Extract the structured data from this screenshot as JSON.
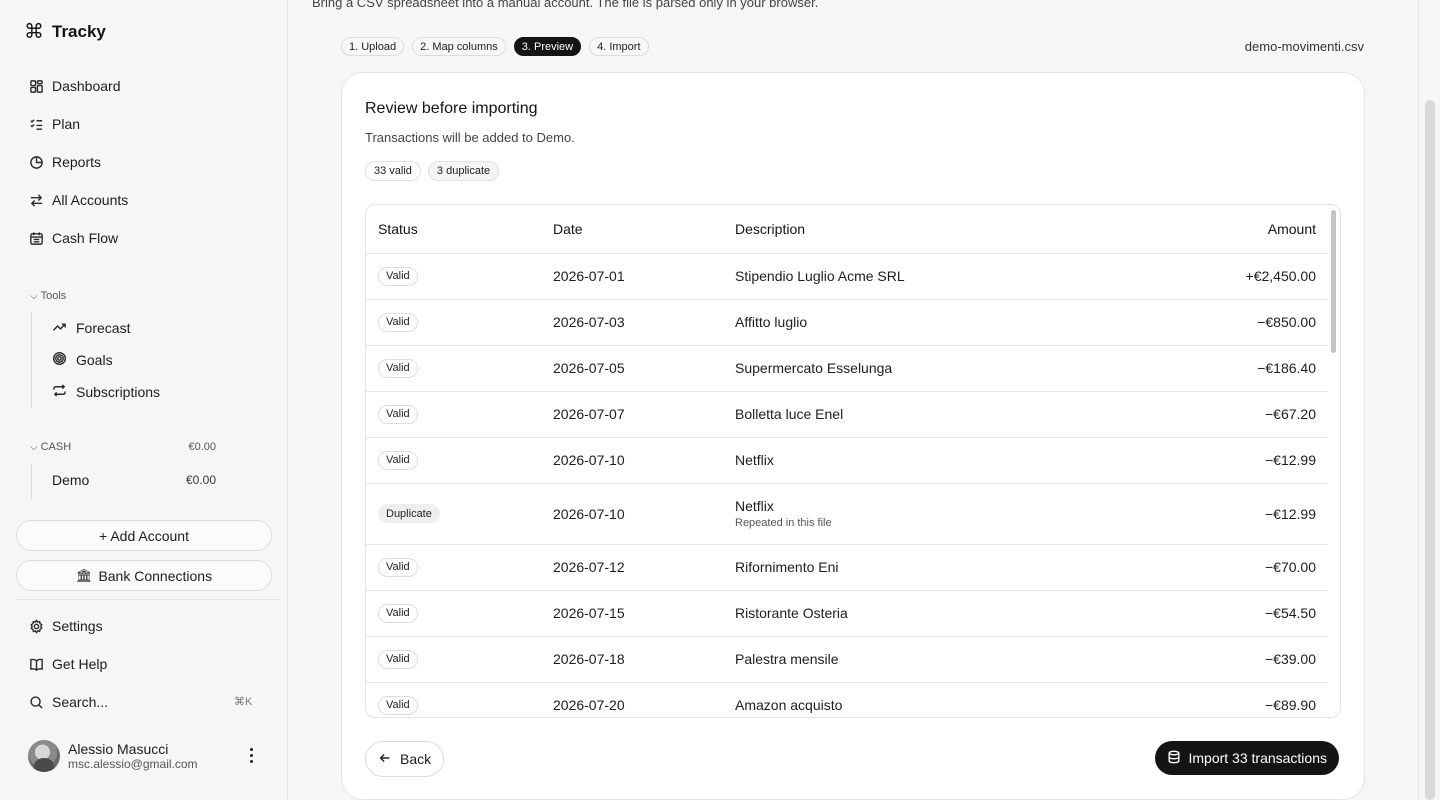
{
  "app": {
    "name": "Tracky",
    "logo_glyph": "⌘"
  },
  "sidebar": {
    "nav": [
      {
        "label": "Dashboard",
        "icon": "grid-icon"
      },
      {
        "label": "Plan",
        "icon": "checklist-icon"
      },
      {
        "label": "Reports",
        "icon": "pie-chart-icon"
      },
      {
        "label": "All Accounts",
        "icon": "transfer-arrows-icon"
      },
      {
        "label": "Cash Flow",
        "icon": "calendar-icon"
      }
    ],
    "tools_label": "Tools",
    "tools": [
      {
        "label": "Forecast",
        "icon": "trend-icon"
      },
      {
        "label": "Goals",
        "icon": "target-icon"
      },
      {
        "label": "Subscriptions",
        "icon": "repeat-icon"
      }
    ],
    "cash_group": {
      "label": "CASH",
      "total": "€0.00"
    },
    "accounts": [
      {
        "name": "Demo",
        "balance": "€0.00"
      }
    ],
    "add_account": "+ Add Account",
    "bank_connections": "Bank Connections",
    "settings": "Settings",
    "get_help": "Get Help",
    "search": "Search...",
    "search_shortcut": "⌘K",
    "user": {
      "name": "Alessio Masucci",
      "email": "msc.alessio@gmail.com"
    }
  },
  "main": {
    "subtitle": "Bring a CSV spreadsheet into a manual account. The file is parsed only in your browser.",
    "steps": [
      {
        "label": "1. Upload",
        "active": false
      },
      {
        "label": "2. Map columns",
        "active": false
      },
      {
        "label": "3. Preview",
        "active": true
      },
      {
        "label": "4. Import",
        "active": false
      }
    ],
    "filename": "demo-movimenti.csv",
    "card": {
      "title": "Review before importing",
      "subtitle": "Transactions will be added to Demo.",
      "badges": [
        "33 valid",
        "3 duplicate"
      ],
      "columns": [
        "Status",
        "Date",
        "Description",
        "Amount"
      ],
      "rows": [
        {
          "status": "Valid",
          "date": "2026-07-01",
          "description": "Stipendio Luglio Acme SRL",
          "note": "",
          "amount": "+€2,450.00"
        },
        {
          "status": "Valid",
          "date": "2026-07-03",
          "description": "Affitto luglio",
          "note": "",
          "amount": "−€850.00"
        },
        {
          "status": "Valid",
          "date": "2026-07-05",
          "description": "Supermercato Esselunga",
          "note": "",
          "amount": "−€186.40"
        },
        {
          "status": "Valid",
          "date": "2026-07-07",
          "description": "Bolletta luce Enel",
          "note": "",
          "amount": "−€67.20"
        },
        {
          "status": "Valid",
          "date": "2026-07-10",
          "description": "Netflix",
          "note": "",
          "amount": "−€12.99"
        },
        {
          "status": "Duplicate",
          "date": "2026-07-10",
          "description": "Netflix",
          "note": "Repeated in this file",
          "amount": "−€12.99"
        },
        {
          "status": "Valid",
          "date": "2026-07-12",
          "description": "Rifornimento Eni",
          "note": "",
          "amount": "−€70.00"
        },
        {
          "status": "Valid",
          "date": "2026-07-15",
          "description": "Ristorante Osteria",
          "note": "",
          "amount": "−€54.50"
        },
        {
          "status": "Valid",
          "date": "2026-07-18",
          "description": "Palestra mensile",
          "note": "",
          "amount": "−€39.00"
        },
        {
          "status": "Valid",
          "date": "2026-07-20",
          "description": "Amazon acquisto",
          "note": "",
          "amount": "−€89.90"
        }
      ],
      "back_label": "Back",
      "import_label": "Import 33 transactions"
    }
  }
}
